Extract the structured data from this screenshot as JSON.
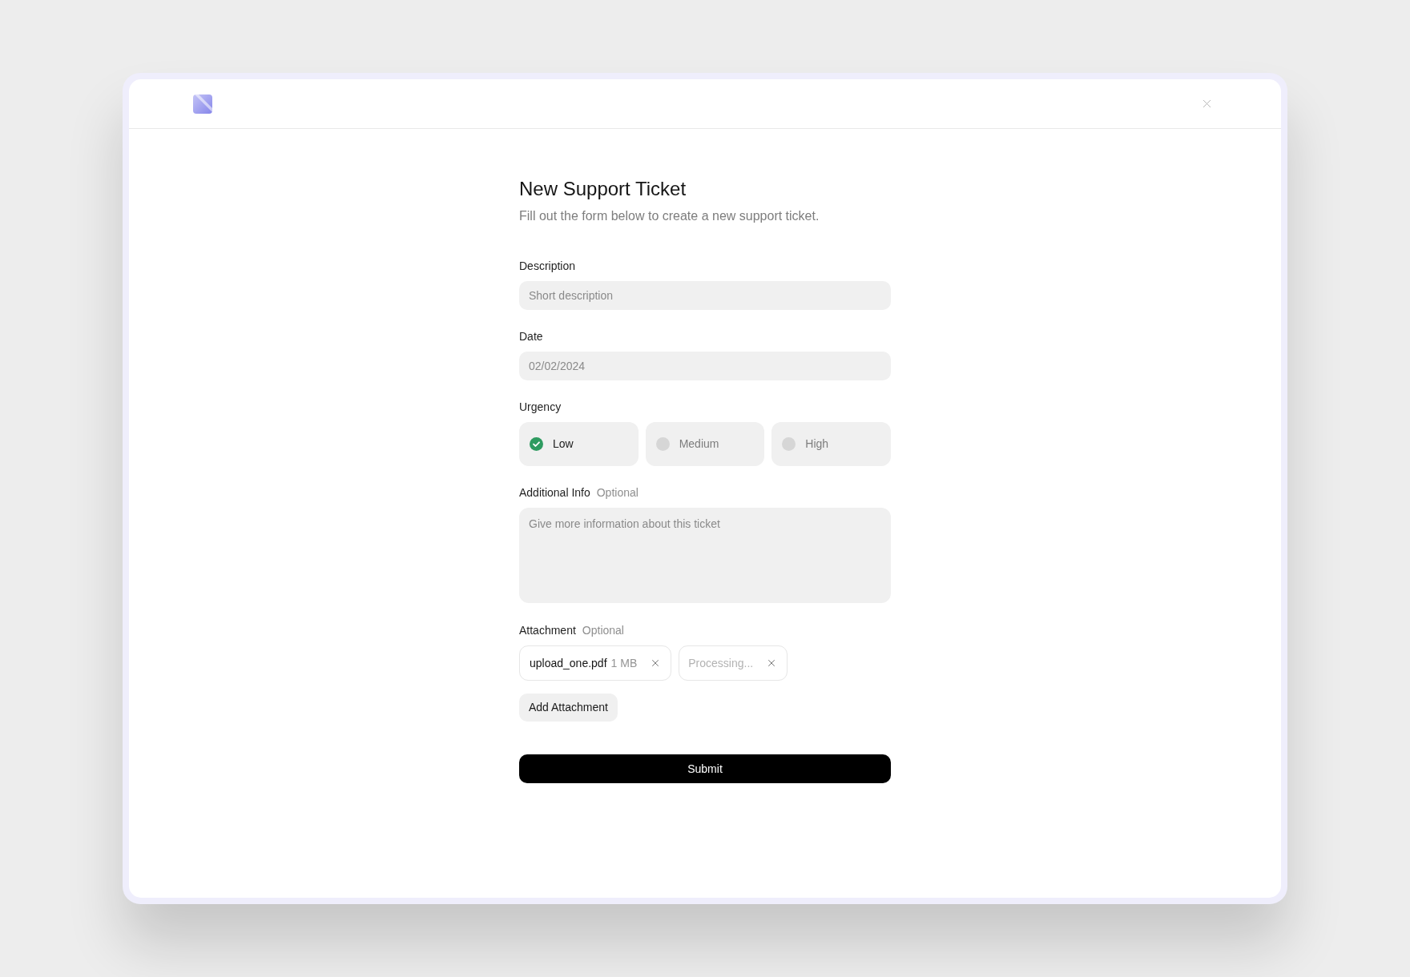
{
  "form": {
    "title": "New Support Ticket",
    "subtitle": "Fill out the form below to create a new support ticket.",
    "description": {
      "label": "Description",
      "placeholder": "Short description"
    },
    "date": {
      "label": "Date",
      "placeholder": "02/02/2024"
    },
    "urgency": {
      "label": "Urgency",
      "options": [
        {
          "label": "Low",
          "selected": true
        },
        {
          "label": "Medium",
          "selected": false
        },
        {
          "label": "High",
          "selected": false
        }
      ]
    },
    "additional_info": {
      "label": "Additional Info",
      "hint": "Optional",
      "placeholder": "Give more information about this ticket"
    },
    "attachment": {
      "label": "Attachment",
      "hint": "Optional",
      "files": [
        {
          "kind": "file",
          "name": "upload_one.pdf",
          "size": "1 MB"
        },
        {
          "kind": "processing",
          "status": "Processing..."
        }
      ],
      "add_button": "Add Attachment"
    },
    "submit_button": "Submit"
  }
}
